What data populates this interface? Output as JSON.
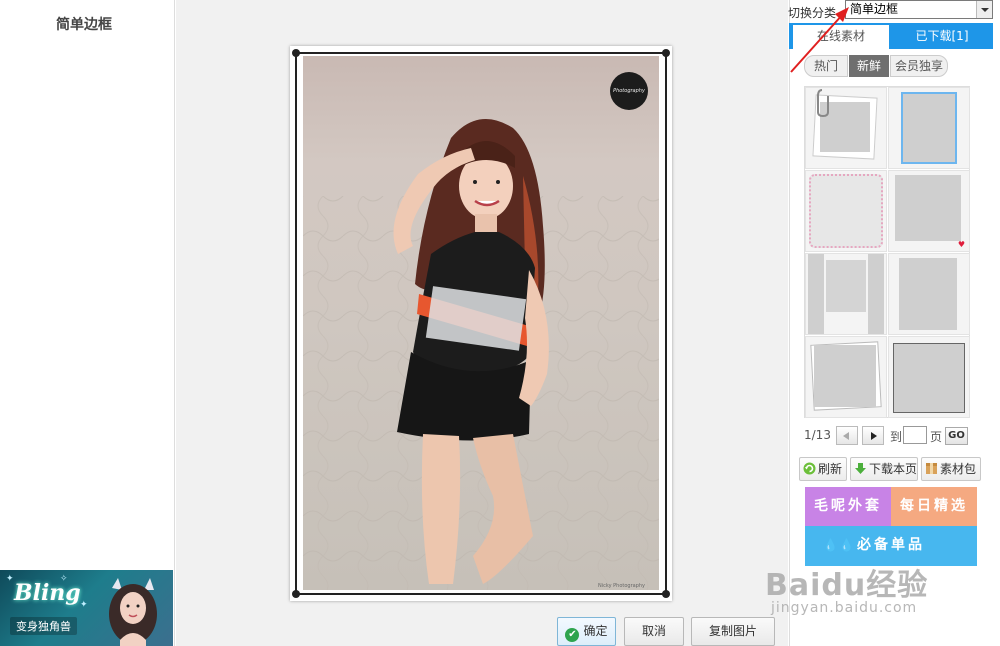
{
  "left_panel": {
    "title": "简单边框",
    "ad": {
      "title": "Bling",
      "subtitle": "变身独角兽"
    }
  },
  "canvas": {
    "watermark_badge": "Photography",
    "credit": "Nicky Photography"
  },
  "bottom_buttons": {
    "confirm": "确定",
    "cancel": "取消",
    "copy": "复制图片"
  },
  "right_panel": {
    "switch_label": "切换分类",
    "category_selected": "简单边框",
    "tabs": {
      "online": "在线素材",
      "downloaded": "已下载[1]"
    },
    "sub_tabs": {
      "hot": "热门",
      "new": "新鲜",
      "vip": "会员独享"
    },
    "frames": [
      {
        "name": "paperclip-frame"
      },
      {
        "name": "blue-border-frame"
      },
      {
        "name": "pink-dotted-frame"
      },
      {
        "name": "heart-corner-frame"
      },
      {
        "name": "side-panels-frame"
      },
      {
        "name": "gray-border-frame"
      },
      {
        "name": "tilted-layer-frame"
      },
      {
        "name": "dark-edge-frame"
      }
    ],
    "pager": {
      "current": "1/13",
      "goto_label": "到",
      "page_suffix": "页",
      "go": "GO"
    },
    "actions": {
      "refresh": "刷新",
      "download_page": "下载本页",
      "asset_pack": "素材包"
    },
    "promos": {
      "takeaway": "毛呢外套",
      "daily": "每日精选",
      "musthave": "必备单品"
    }
  },
  "colors": {
    "tab_blue": "#1e96e8",
    "promo_purple": "#c883e6",
    "promo_orange": "#f5a981",
    "promo_blue": "#47b7ef",
    "arrow_red": "#e02020"
  },
  "watermark": {
    "logo": "Baidu经验",
    "url": "jingyan.baidu.com"
  }
}
